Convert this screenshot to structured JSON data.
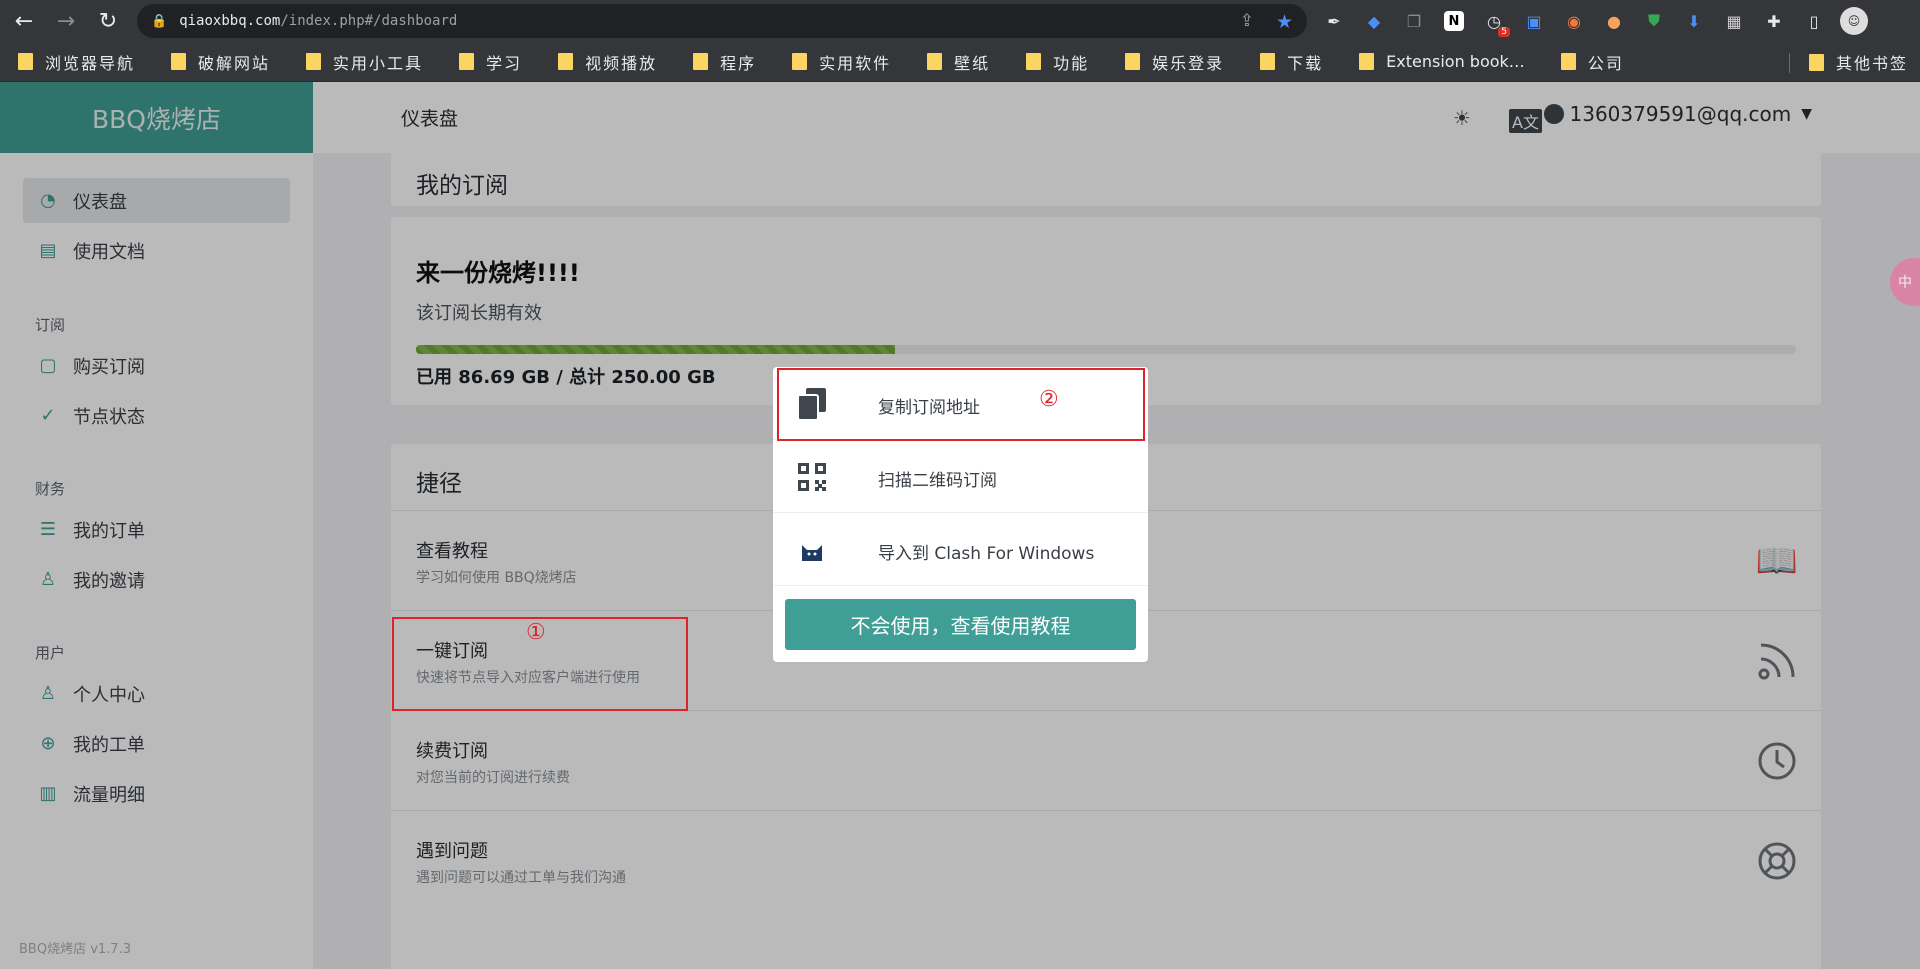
{
  "browser": {
    "url_host": "qiaoxbbq.com",
    "url_path": "/index.php#/dashboard",
    "nav": {
      "back_icon": "←",
      "forward_icon": "→",
      "reload_icon": "↻"
    },
    "extension_badge": "5",
    "bookmarks": [
      "浏览器导航",
      "破解网站",
      "实用小工具",
      "学习",
      "视频播放",
      "程序",
      "实用软件",
      "壁纸",
      "功能",
      "娱乐登录",
      "下载",
      "Extension book…",
      "公司"
    ],
    "other_bookmarks": "其他书签"
  },
  "app": {
    "brand": "BBQ烧烤店",
    "version": "BBQ烧烤店 v1.7.3",
    "sidebar": {
      "items": [
        {
          "label": "仪表盘",
          "icon": "dashboard-icon"
        },
        {
          "label": "使用文档",
          "icon": "book-icon"
        }
      ],
      "groups": [
        {
          "title": "订阅",
          "items": [
            {
              "label": "购买订阅",
              "icon": "clipboard-icon"
            },
            {
              "label": "节点状态",
              "icon": "check-circle-icon"
            }
          ]
        },
        {
          "title": "财务",
          "items": [
            {
              "label": "我的订单",
              "icon": "list-icon"
            },
            {
              "label": "我的邀请",
              "icon": "user-invite-icon"
            }
          ]
        },
        {
          "title": "用户",
          "items": [
            {
              "label": "个人中心",
              "icon": "user-icon"
            },
            {
              "label": "我的工单",
              "icon": "lifebuoy-icon"
            },
            {
              "label": "流量明细",
              "icon": "bar-chart-icon"
            }
          ]
        }
      ]
    },
    "topbar": {
      "title": "仪表盘",
      "theme_icon": "sun-icon",
      "translate_icon": "translate-icon",
      "user_email": "1360379591@qq.com"
    },
    "subscription": {
      "header": "我的订阅",
      "plan_name": "来一份烧烤!!!!",
      "validity": "该订阅长期有效",
      "usage_fraction": 0.347,
      "usage_text": "已用 86.69 GB / 总计 250.00 GB"
    },
    "shortcuts": {
      "header": "捷径",
      "items": [
        {
          "title": "查看教程",
          "desc": "学习如何使用 BBQ烧烤店",
          "icon": "open-book-icon"
        },
        {
          "title": "一键订阅",
          "desc": "快速将节点导入对应客户端进行使用",
          "icon": "rss-icon"
        },
        {
          "title": "续费订阅",
          "desc": "对您当前的订阅进行续费",
          "icon": "clock-icon"
        },
        {
          "title": "遇到问题",
          "desc": "遇到问题可以通过工单与我们沟通",
          "icon": "lifebuoy-icon"
        }
      ]
    },
    "popup": {
      "items": [
        {
          "label": "复制订阅地址",
          "icon": "copy-icon"
        },
        {
          "label": "扫描二维码订阅",
          "icon": "qrcode-icon"
        },
        {
          "label": "导入到 Clash For Windows",
          "icon": "clash-cat-icon"
        }
      ],
      "button": "不会使用，查看使用教程"
    },
    "annotations": {
      "one": "①",
      "two": "②"
    },
    "float_badge": "中"
  },
  "colors": {
    "brand": "#3f9e95",
    "annotation": "#e0232b",
    "progress": "#6ca83a"
  }
}
